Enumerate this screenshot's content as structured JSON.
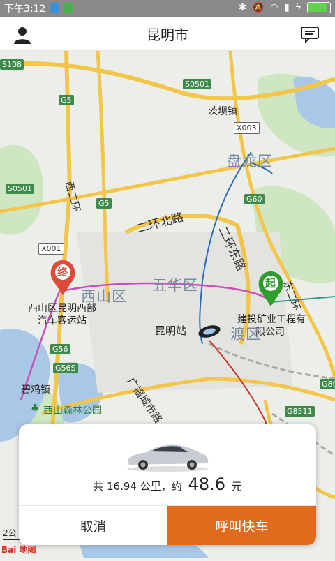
{
  "status_bar": {
    "time": "下午3:12",
    "battery_color": "#5fd44b"
  },
  "header": {
    "title": "昆明市",
    "left_icon": "user-icon",
    "right_icon": "message-icon"
  },
  "map": {
    "districts": [
      "盘龙区",
      "西山区",
      "五华区",
      "渡区"
    ],
    "places": {
      "maoba": "茨坝镇",
      "station": "昆明站",
      "bijizhen": "碧鸡镇",
      "forest_park": "西山森林公园"
    },
    "roads": {
      "er_huan_bei": "二环北路",
      "er_huan_dong": "二环东路",
      "xi_er_huan": "西二环",
      "dong_er_huan": "东二环",
      "yuantong": "广福城市路"
    },
    "shields": [
      "S0501",
      "G5",
      "X003",
      "G60",
      "S0501",
      "G5",
      "X001",
      "G56",
      "G56S",
      "G80",
      "G8511",
      "S108"
    ],
    "start_marker": {
      "char": "起",
      "label_line1": "建投矿业工程有",
      "label_line2": "限公司",
      "color": "#2e9d2e"
    },
    "end_marker": {
      "char": "终",
      "label_line1": "西山区昆明西部",
      "label_line2": "汽车客运站",
      "color": "#e04a3a"
    },
    "scale": "2公",
    "attribution": "Bai 地图"
  },
  "trip": {
    "prefix": "共",
    "distance": "16.94",
    "unit": "公里，约",
    "fare": "48.6",
    "currency": "元",
    "cancel_label": "取消",
    "call_label": "呼叫快车",
    "accent_color": "#e26a1c"
  }
}
